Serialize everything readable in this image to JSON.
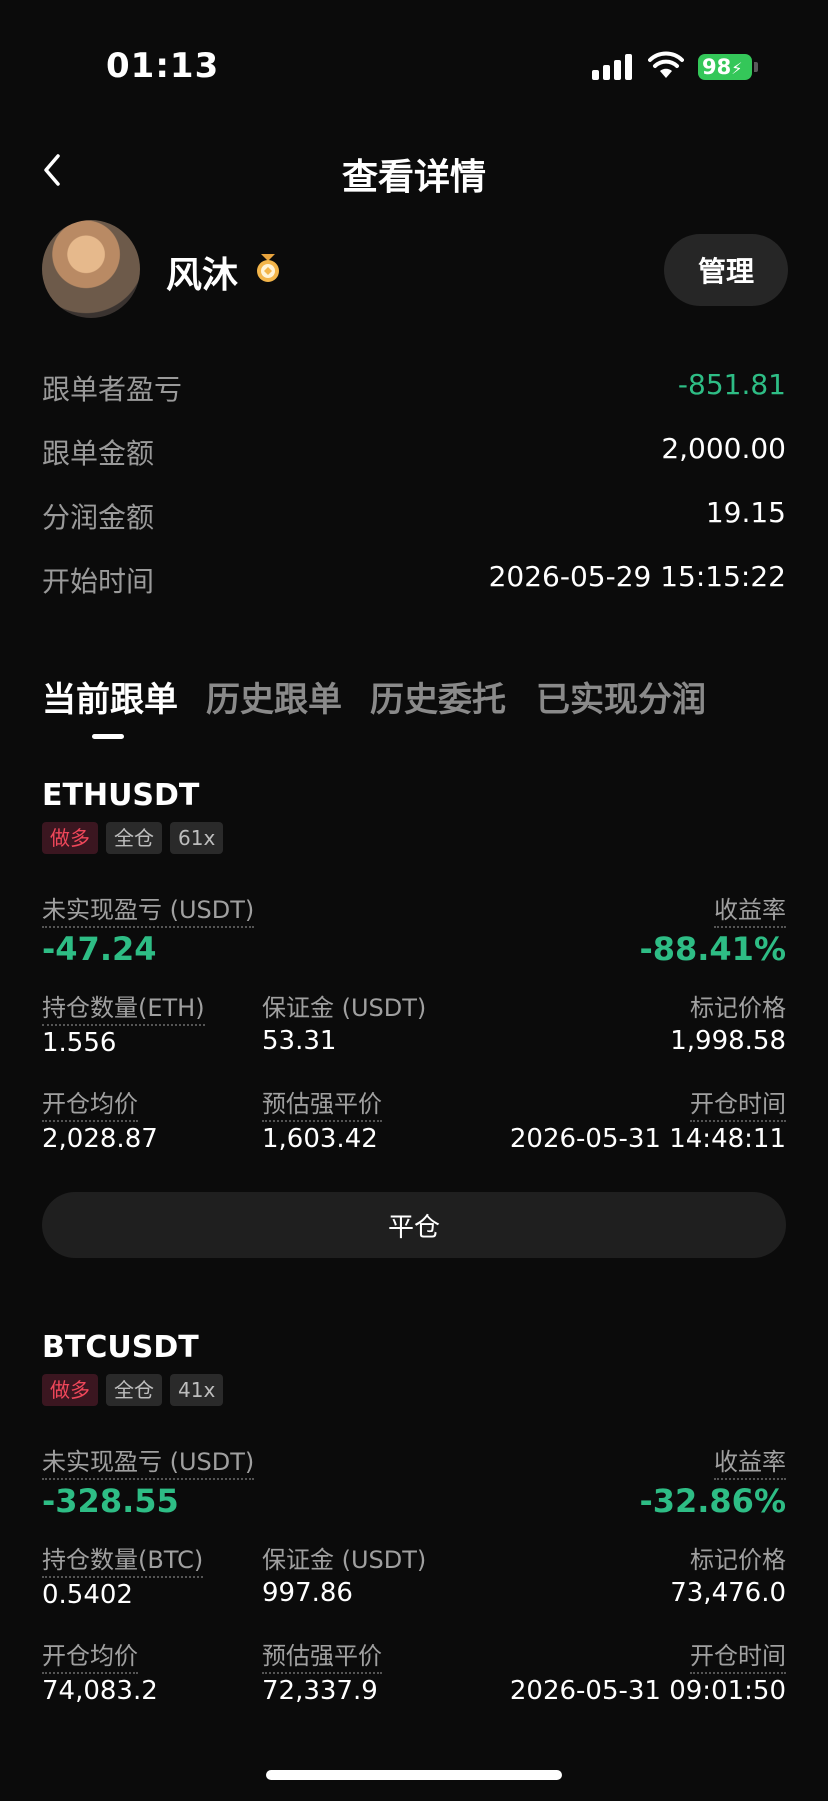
{
  "status": {
    "time": "01:13",
    "battery": "98"
  },
  "header": {
    "title": "查看详情"
  },
  "profile": {
    "name": "风沐",
    "manage_label": "管理"
  },
  "summary": [
    {
      "label": "跟单者盈亏",
      "value": "-851.81"
    },
    {
      "label": "跟单金额",
      "value": "2,000.00"
    },
    {
      "label": "分润金额",
      "value": "19.15"
    },
    {
      "label": "开始时间",
      "value": "2026-05-29 15:15:22"
    }
  ],
  "tabs": [
    "当前跟单",
    "历史跟单",
    "历史委托",
    "已实现分润"
  ],
  "labels": {
    "unrealized": "未实现盈亏 (USDT)",
    "roi": "收益率",
    "margin": "保证金 (USDT)",
    "mark_price": "标记价格",
    "entry_price": "开仓均价",
    "liq_price": "预估强平价",
    "open_time": "开仓时间",
    "close_button": "平仓"
  },
  "positions": [
    {
      "symbol": "ETHUSDT",
      "badges": [
        "做多",
        "全仓",
        "61x"
      ],
      "unrealized": "-47.24",
      "roi": "-88.41%",
      "qty_label": "持仓数量(ETH)",
      "qty": "1.556",
      "margin": "53.31",
      "mark_price": "1,998.58",
      "entry_price": "2,028.87",
      "liq_price": "1,603.42",
      "open_time": "2026-05-31 14:48:11"
    },
    {
      "symbol": "BTCUSDT",
      "badges": [
        "做多",
        "全仓",
        "41x"
      ],
      "unrealized": "-328.55",
      "roi": "-32.86%",
      "qty_label": "持仓数量(BTC)",
      "qty": "0.5402",
      "margin": "997.86",
      "mark_price": "73,476.0",
      "entry_price": "74,083.2",
      "liq_price": "72,337.9",
      "open_time": "2026-05-31 09:01:50"
    }
  ]
}
